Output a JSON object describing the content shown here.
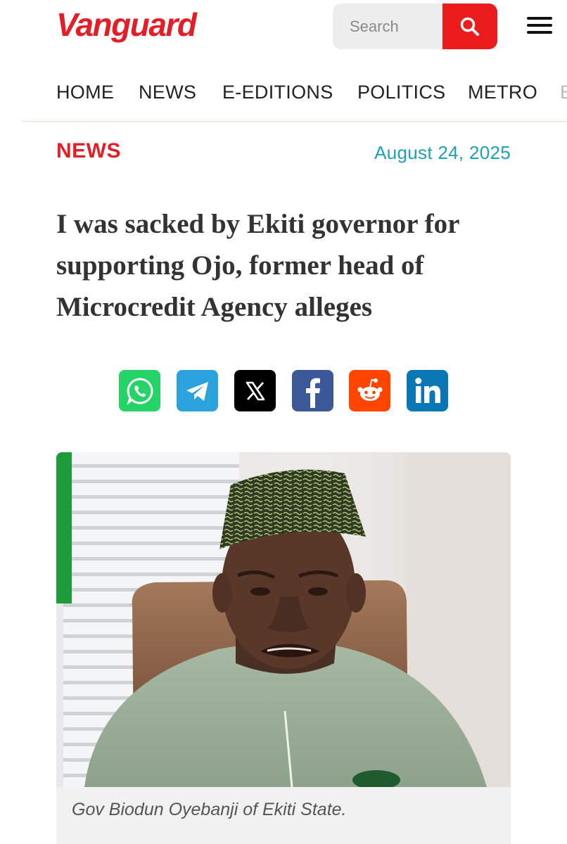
{
  "header": {
    "logo": "Vanguard",
    "search_placeholder": "Search"
  },
  "nav": {
    "items": [
      "HOME",
      "NEWS",
      "E-EDITIONS",
      "POLITICS",
      "METRO",
      "E"
    ]
  },
  "article": {
    "category": "NEWS",
    "date": "August 24, 2025",
    "headline": "I was sacked by Ekiti governor for supporting Ojo, former head of Microcredit Agency alleges",
    "image_caption": "Gov Biodun Oyebanji of Ekiti State."
  },
  "share": [
    {
      "name": "whatsapp",
      "icon": "whatsapp-icon",
      "color": "#25d366"
    },
    {
      "name": "telegram",
      "icon": "telegram-icon",
      "color": "#2aa3dc"
    },
    {
      "name": "x",
      "icon": "x-icon",
      "color": "#000000"
    },
    {
      "name": "facebook",
      "icon": "facebook-icon",
      "color": "#3b5998"
    },
    {
      "name": "reddit",
      "icon": "reddit-icon",
      "color": "#ff4500"
    },
    {
      "name": "linkedin",
      "icon": "linkedin-icon",
      "color": "#0a77b5"
    }
  ],
  "colors": {
    "brand_red": "#e41e26",
    "date_teal": "#1ea1b6"
  }
}
